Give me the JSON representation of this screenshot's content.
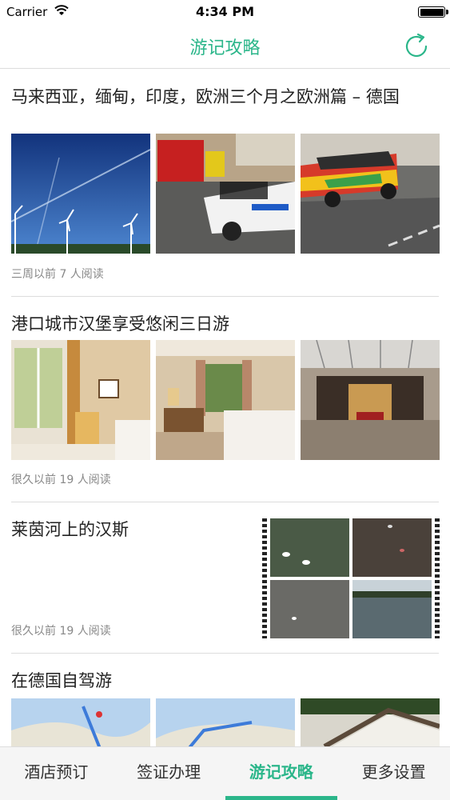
{
  "status_bar": {
    "carrier": "Carrier",
    "time": "4:34 PM"
  },
  "nav": {
    "title": "游记攻略",
    "refresh_icon": "refresh-icon"
  },
  "articles": [
    {
      "title": "马来西亚，缅甸，印度，欧洲三个月之欧洲篇 – 德国",
      "meta": "三周以前   7 人阅读"
    },
    {
      "title": "港口城市汉堡享受悠闲三日游",
      "meta": "很久以前   19 人阅读"
    },
    {
      "title": "莱茵河上的汉斯",
      "meta": "很久以前   19 人阅读"
    },
    {
      "title": "在德国自驾游"
    }
  ],
  "tabs": [
    {
      "label": "酒店预订"
    },
    {
      "label": "签证办理"
    },
    {
      "label": "游记攻略"
    },
    {
      "label": "更多设置"
    }
  ],
  "colors": {
    "accent": "#2bb68a"
  }
}
